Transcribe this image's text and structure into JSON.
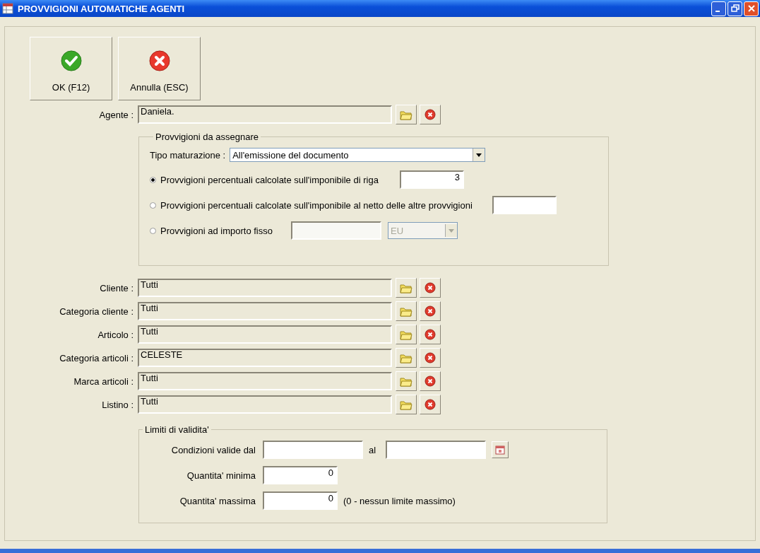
{
  "window": {
    "title": "PROVVIGIONI AUTOMATICHE AGENTI"
  },
  "toolbar": [
    {
      "label": "OK (F12)",
      "kind": "ok"
    },
    {
      "label": "Annulla (ESC)",
      "kind": "cancel"
    }
  ],
  "agent": {
    "label": "Agente :",
    "value": "Daniela."
  },
  "commission_group": {
    "title": "Provvigioni da assegnare",
    "accrual": {
      "label": "Tipo maturazione :",
      "value": "All'emissione del documento"
    },
    "options": [
      {
        "label": "Provvigioni percentuali calcolate sull'imponibile di riga",
        "selected": true,
        "value": "3"
      },
      {
        "label": "Provvigioni percentuali calcolate sull'imponibile al netto delle altre provvigioni",
        "selected": false
      },
      {
        "label": "Provvigioni ad importo fisso",
        "selected": false,
        "currency": {
          "value": "EU",
          "disabled": true
        }
      }
    ]
  },
  "filters": [
    {
      "label": "Cliente :",
      "value": "Tutti"
    },
    {
      "label": "Categoria cliente :",
      "value": "Tutti"
    },
    {
      "label": "Articolo :",
      "value": "Tutti"
    },
    {
      "label": "Categoria articoli :",
      "value": "CELESTE"
    },
    {
      "label": "Marca articoli :",
      "value": "Tutti"
    },
    {
      "label": "Listino :",
      "value": "Tutti"
    }
  ],
  "validity_group": {
    "title": "Limiti di validita'",
    "from_label": "Condizioni valide dal",
    "to_label": "al",
    "min": {
      "label": "Quantita' minima",
      "value": "0"
    },
    "max": {
      "label": "Quantita' massima",
      "value": "0",
      "note": "(0 - nessun limite massimo)"
    }
  }
}
